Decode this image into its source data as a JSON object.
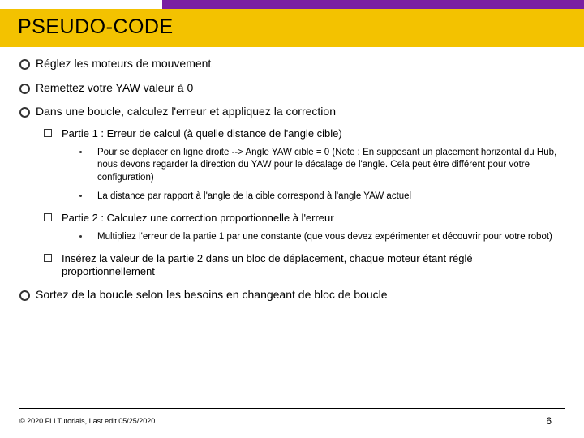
{
  "title": "PSEUDO-CODE",
  "bullets": {
    "b1": "Réglez les moteurs de mouvement",
    "b2": "Remettez votre YAW valeur à 0",
    "b3": "Dans une boucle, calculez l'erreur et appliquez la correction",
    "b3_s1": "Partie 1 : Erreur de calcul (à quelle distance de l'angle cible)",
    "b3_s1_d1": "Pour se déplacer en ligne droite --> Angle YAW cible = 0 (Note : En supposant un placement horizontal du Hub, nous devons regarder la direction du YAW pour le décalage de l'angle. Cela peut être différent pour votre configuration)",
    "b3_s1_d2": "La distance par rapport à l'angle de la cible correspond à l'angle YAW actuel",
    "b3_s2": "Partie 2 : Calculez une correction proportionnelle à l'erreur",
    "b3_s2_d1": "Multipliez l'erreur de la partie 1 par une constante (que vous devez expérimenter et découvrir pour votre robot)",
    "b3_s3": "Insérez la valeur de la partie 2 dans un bloc de déplacement, chaque moteur étant réglé proportionnellement",
    "b4": "Sortez de la boucle selon les besoins en changeant de bloc de boucle"
  },
  "footer": {
    "copyright": "© 2020 FLLTutorials, Last edit 05/25/2020",
    "page": "6"
  },
  "colors": {
    "accent_purple": "#7a1fa2",
    "accent_yellow": "#f3c200"
  }
}
